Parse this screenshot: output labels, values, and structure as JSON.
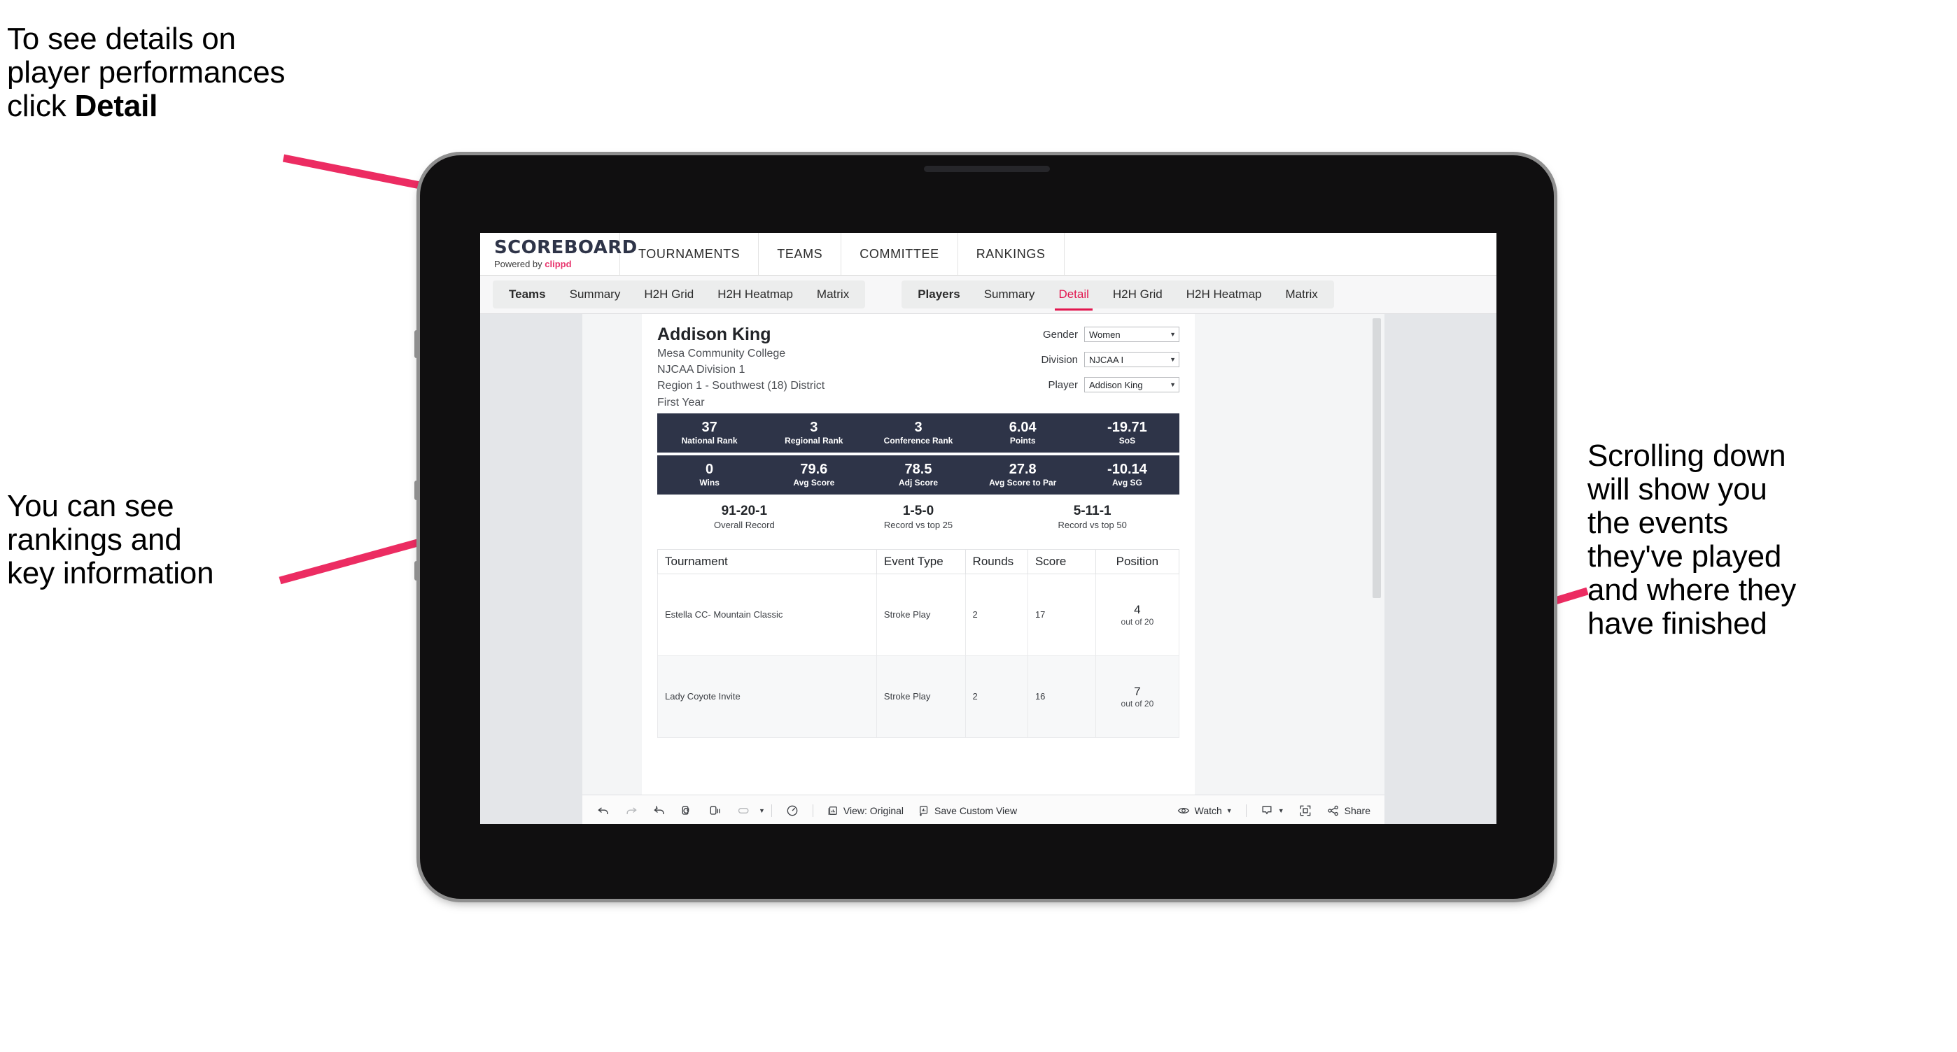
{
  "annotations": {
    "top_left": "To see details on\nplayer performances\nclick ",
    "top_left_bold": "Detail",
    "mid_left": "You can see\nrankings and\nkey information",
    "right": "Scrolling down\nwill show you\nthe events\nthey've played\nand where they\nhave finished",
    "arrow_color": "#ec2c62"
  },
  "app": {
    "brand": {
      "logo": "SCOREBOARD",
      "powered_prefix": "Powered by ",
      "powered_name": "clippd"
    },
    "topnav": [
      "TOURNAMENTS",
      "TEAMS",
      "COMMITTEE",
      "RANKINGS"
    ],
    "subnav": {
      "group_teams": [
        {
          "label": "Teams",
          "lead": true,
          "active": false
        },
        {
          "label": "Summary",
          "lead": false,
          "active": false
        },
        {
          "label": "H2H Grid",
          "lead": false,
          "active": false
        },
        {
          "label": "H2H Heatmap",
          "lead": false,
          "active": false
        },
        {
          "label": "Matrix",
          "lead": false,
          "active": false
        }
      ],
      "group_players": [
        {
          "label": "Players",
          "lead": true,
          "active": false
        },
        {
          "label": "Summary",
          "lead": false,
          "active": false
        },
        {
          "label": "Detail",
          "lead": false,
          "active": true
        },
        {
          "label": "H2H Grid",
          "lead": false,
          "active": false
        },
        {
          "label": "H2H Heatmap",
          "lead": false,
          "active": false
        },
        {
          "label": "Matrix",
          "lead": false,
          "active": false
        }
      ]
    },
    "player": {
      "name": "Addison King",
      "school": "Mesa Community College",
      "division": "NJCAA Division 1",
      "region": "Region 1 - Southwest (18) District",
      "year": "First Year"
    },
    "filters": [
      {
        "label": "Gender",
        "value": "Women"
      },
      {
        "label": "Division",
        "value": "NJCAA I"
      },
      {
        "label": "Player",
        "value": "Addison King"
      }
    ],
    "stat_band_1": [
      {
        "value": "37",
        "label": "National Rank"
      },
      {
        "value": "3",
        "label": "Regional Rank"
      },
      {
        "value": "3",
        "label": "Conference Rank"
      },
      {
        "value": "6.04",
        "label": "Points"
      },
      {
        "value": "-19.71",
        "label": "SoS"
      }
    ],
    "stat_band_2": [
      {
        "value": "0",
        "label": "Wins"
      },
      {
        "value": "79.6",
        "label": "Avg Score"
      },
      {
        "value": "78.5",
        "label": "Adj Score"
      },
      {
        "value": "27.8",
        "label": "Avg Score to Par"
      },
      {
        "value": "-10.14",
        "label": "Avg SG"
      }
    ],
    "records": [
      {
        "value": "91-20-1",
        "label": "Overall Record"
      },
      {
        "value": "1-5-0",
        "label": "Record vs top 25"
      },
      {
        "value": "5-11-1",
        "label": "Record vs top 50"
      }
    ],
    "table": {
      "headers": [
        "Tournament",
        "Event Type",
        "Rounds",
        "Score",
        "Position"
      ],
      "rows": [
        {
          "tournament": "Estella CC- Mountain Classic",
          "event_type": "Stroke Play",
          "rounds": "2",
          "score": "17",
          "position_num": "4",
          "position_of": "out of 20"
        },
        {
          "tournament": "Lady Coyote Invite",
          "event_type": "Stroke Play",
          "rounds": "2",
          "score": "16",
          "position_num": "7",
          "position_of": "out of 20"
        }
      ]
    },
    "bottom_toolbar": {
      "view_label": "View: Original",
      "save_label": "Save Custom View",
      "watch_label": "Watch",
      "share_label": "Share"
    }
  }
}
